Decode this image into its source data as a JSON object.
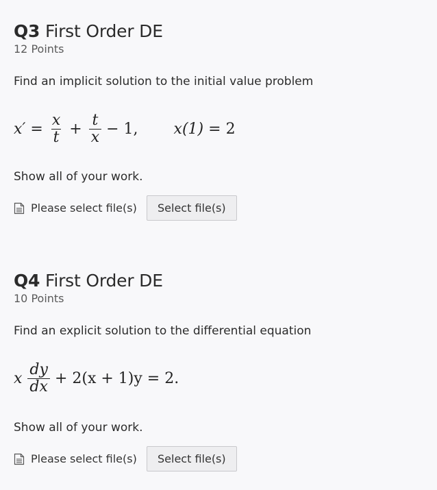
{
  "q3": {
    "number": "Q3",
    "title": "First Order DE",
    "points": "12 Points",
    "prompt": "Find an implicit solution to the initial value problem",
    "equation": {
      "lhs": "x′",
      "eq": "=",
      "frac1_num": "x",
      "frac1_den": "t",
      "plus": "+",
      "frac2_num": "t",
      "frac2_den": "x",
      "tail": "− 1,",
      "ic_lhs": "x(1)",
      "ic_eq": "=",
      "ic_rhs": "2"
    },
    "show_work": "Show all of your work.",
    "upload_label": "Please select file(s)",
    "button_label": "Select file(s)"
  },
  "q4": {
    "number": "Q4",
    "title": "First Order DE",
    "points": "10 Points",
    "prompt": "Find an explicit solution to the differential equation",
    "equation": {
      "x": "x",
      "frac_num": "dy",
      "frac_den": "dx",
      "rest": "+ 2(x + 1)y = 2."
    },
    "show_work": "Show all of your work.",
    "upload_label": "Please select file(s)",
    "button_label": "Select file(s)"
  },
  "icons": {
    "upload": "document-icon"
  }
}
